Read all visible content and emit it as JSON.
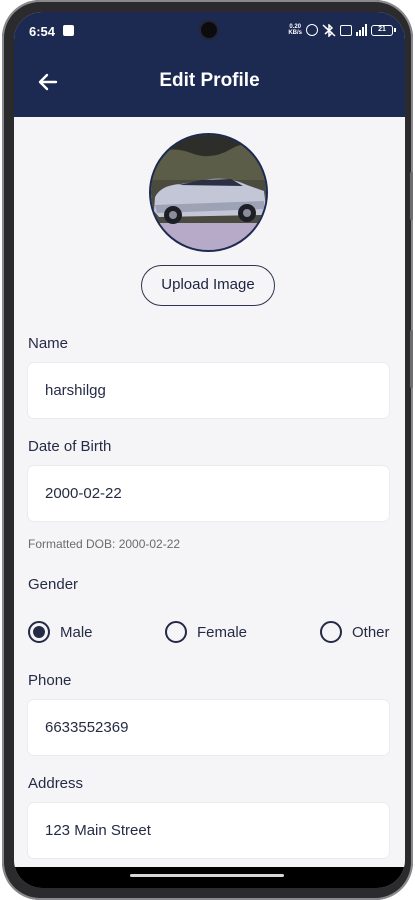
{
  "status_bar": {
    "time": "6:54",
    "net_speed_value": "0.20",
    "net_speed_unit": "KB/s",
    "battery_level": "21"
  },
  "header": {
    "title": "Edit Profile",
    "back_icon": "arrow-left-icon",
    "background_color": "#1c2a52"
  },
  "profile": {
    "upload_button_label": "Upload Image"
  },
  "form": {
    "name": {
      "label": "Name",
      "value": "harshilgg"
    },
    "dob": {
      "label": "Date of Birth",
      "value": "2000-02-22",
      "formatted": "Formatted DOB: 2000-02-22"
    },
    "gender": {
      "label": "Gender",
      "options": [
        "Male",
        "Female",
        "Other"
      ],
      "selected": "Male"
    },
    "phone": {
      "label": "Phone",
      "value": "6633552369"
    },
    "address": {
      "label": "Address",
      "value": "123 Main Street"
    }
  }
}
